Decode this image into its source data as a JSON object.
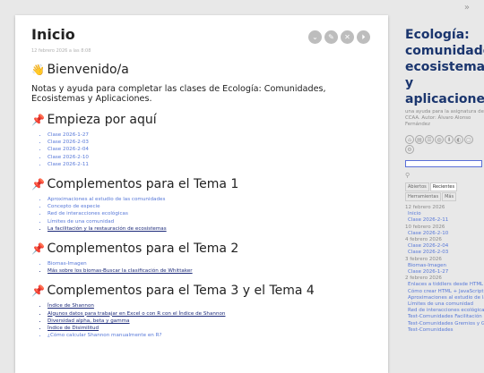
{
  "collapse_icon": "chevron-double-right-icon",
  "tiddler": {
    "title": "Inicio",
    "subtitle": "12 febrero 2026 a las 8:08",
    "control_icons": [
      "chevron-down-icon",
      "edit-icon",
      "close-icon",
      "more-icon"
    ],
    "welcome_heading": "Bienvenido/a",
    "intro": "Notas y ayuda para completar las clases de Ecología: Comunidades, Ecosistemas y Aplicaciones.",
    "sections": [
      {
        "heading": "Empieza por aquí",
        "items": [
          {
            "label": "Clase 2026-1-27",
            "style": "link"
          },
          {
            "label": "Clase 2026-2-03",
            "style": "link"
          },
          {
            "label": "Clase 2026-2-04",
            "style": "link"
          },
          {
            "label": "Clase 2026-2-10",
            "style": "link"
          },
          {
            "label": "Clase 2026-2-11",
            "style": "link"
          }
        ]
      },
      {
        "heading": "Complementos para el Tema 1",
        "items": [
          {
            "label": "Aproximaciones al estudio de las comunidades",
            "style": "link"
          },
          {
            "label": "Concepto de especie",
            "style": "link"
          },
          {
            "label": "Red de interacciones ecológicas",
            "style": "link"
          },
          {
            "label": "Límites de una comunidad",
            "style": "link"
          },
          {
            "label": "La facilitación y la restauración de ecosistemas",
            "style": "dark"
          }
        ]
      },
      {
        "heading": "Complementos para el Tema 2",
        "items": [
          {
            "label": "Biomas-Imagen",
            "style": "link"
          },
          {
            "label": "Más sobre los biomas-Buscar la clasificación de Whittaker",
            "style": "dark"
          }
        ]
      },
      {
        "heading": "Complementos para el Tema 3 y el Tema 4",
        "items": [
          {
            "label": "Índice de Shannon",
            "style": "dark"
          },
          {
            "label": "Algunos datos para trabajar en Excel o con R con el Índice de Shannon",
            "style": "dark"
          },
          {
            "label": "Diversidad alpha, beta y gamma",
            "style": "dark"
          },
          {
            "label": "Índice de Disimilitud",
            "style": "dark"
          },
          {
            "label": "¿Cómo calcular Shannon manualmente en R?",
            "style": "link"
          }
        ]
      }
    ]
  },
  "sidebar": {
    "title": "Ecología: comunidades, ecosistemas y aplicaciones",
    "subtitle": "una ayuda para la asignatura de CCAA. Autor: Álvaro Alonso Fernández",
    "icons": [
      "home-icon",
      "file-icon",
      "settings-icon",
      "globe-icon",
      "save-icon",
      "theme-icon",
      "fullscreen-icon",
      "gear-icon"
    ],
    "search_icon": "search-icon",
    "tabs": [
      {
        "label": "Abiertos",
        "active": false
      },
      {
        "label": "Recientes",
        "active": true
      },
      {
        "label": "Herramientas",
        "active": false
      },
      {
        "label": "Más",
        "active": false
      }
    ],
    "recent": [
      {
        "type": "date",
        "label": "12 febrero 2026"
      },
      {
        "type": "item",
        "label": "Inicio"
      },
      {
        "type": "item",
        "label": "Clase 2026-2-11"
      },
      {
        "type": "date",
        "label": "10 febrero 2026"
      },
      {
        "type": "item",
        "label": "Clase 2026-2-10"
      },
      {
        "type": "date",
        "label": "4 febrero 2026"
      },
      {
        "type": "item",
        "label": "Clase 2026-2-04"
      },
      {
        "type": "item",
        "label": "Clase 2026-2-03"
      },
      {
        "type": "date",
        "label": "3 febrero 2026"
      },
      {
        "type": "item",
        "label": "Biomas-Imagen"
      },
      {
        "type": "item",
        "label": "Clase 2026-1-27"
      },
      {
        "type": "date",
        "label": "2 febrero 2026"
      },
      {
        "type": "item",
        "label": "Enlaces a tiddlers desde HTML"
      },
      {
        "type": "item",
        "label": "Cómo crear HTML + JavaScript"
      },
      {
        "type": "item",
        "label": "Aproximaciones al estudio de la"
      },
      {
        "type": "item",
        "label": "Límites de una comunidad"
      },
      {
        "type": "item",
        "label": "Red de interacciones ecológica"
      },
      {
        "type": "item",
        "label": "Test-Comunidades Facilitación"
      },
      {
        "type": "item",
        "label": "Test-Comunidades Gremios y G"
      },
      {
        "type": "item",
        "label": "Test-Comunidades"
      }
    ]
  }
}
